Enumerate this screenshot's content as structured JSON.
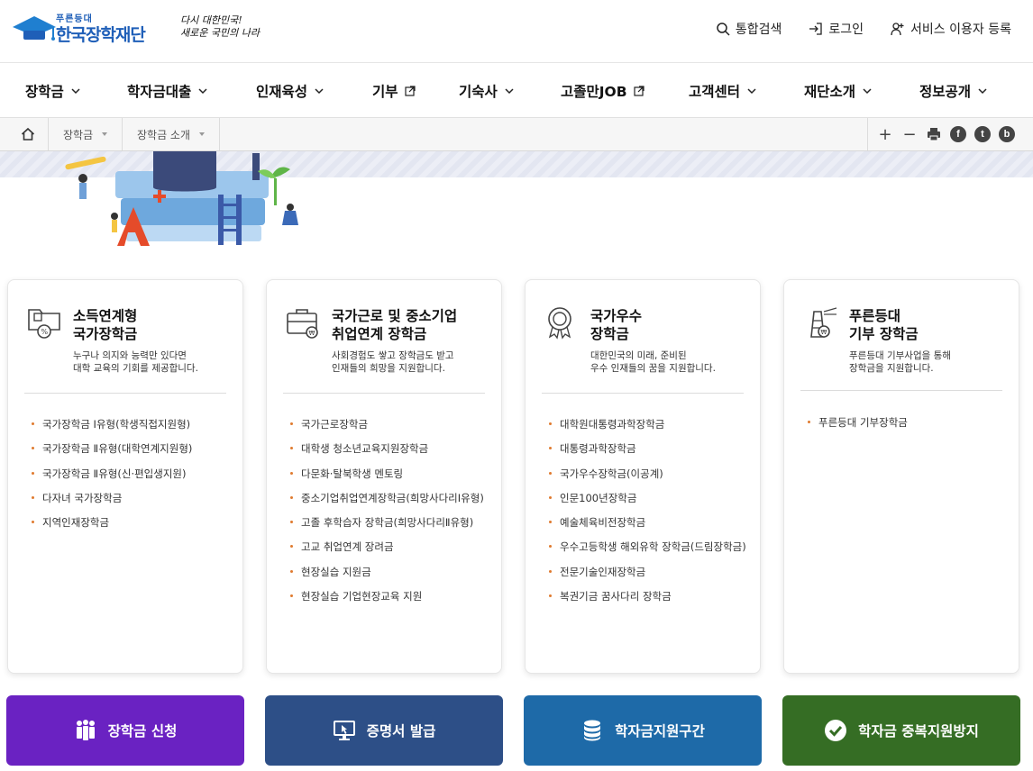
{
  "header": {
    "logo_sub": "푸른등대",
    "logo_name": "한국장학재단",
    "slogan_line1": "다시 대한민국!",
    "slogan_line2": "새로운 국민의 나라",
    "util": [
      {
        "label": "통합검색",
        "icon": "search-icon"
      },
      {
        "label": "로그인",
        "icon": "login-icon"
      },
      {
        "label": "서비스 이용자 등록",
        "icon": "user-add-icon"
      }
    ]
  },
  "gnb": [
    {
      "label": "장학금",
      "icon": "chevron-down-icon"
    },
    {
      "label": "학자금대출",
      "icon": "chevron-down-icon"
    },
    {
      "label": "인재육성",
      "icon": "chevron-down-icon"
    },
    {
      "label": "기부",
      "icon": "external-link-icon"
    },
    {
      "label": "기숙사",
      "icon": "chevron-down-icon"
    },
    {
      "label": "고졸만JOB",
      "icon": "external-link-icon"
    },
    {
      "label": "고객센터",
      "icon": "chevron-down-icon"
    },
    {
      "label": "재단소개",
      "icon": "chevron-down-icon"
    },
    {
      "label": "정보공개",
      "icon": "chevron-down-icon"
    }
  ],
  "breadcrumb": {
    "home_icon": "home-icon",
    "items": [
      "장학금",
      "장학금 소개"
    ]
  },
  "tools": {
    "zoom_in": "+",
    "zoom_out": "−",
    "print_icon": "print-icon",
    "facebook": "f",
    "twitter": "t",
    "blog": "b"
  },
  "cards": [
    {
      "icon": "income-scholarship-icon",
      "title": "소득연계형\n국가장학금",
      "desc": "누구나 의지와 능력만 있다면\n대학 교육의 기회를 제공합니다.",
      "items": [
        "국가장학금 Ⅰ유형(학생직접지원형)",
        "국가장학금 Ⅱ유형(대학연계지원형)",
        "국가장학금 Ⅱ유형(신·편입생지원)",
        "다자녀 국가장학금",
        "지역인재장학금"
      ]
    },
    {
      "icon": "briefcase-icon",
      "title": "국가근로 및 중소기업\n취업연계 장학금",
      "desc": "사회경험도 쌓고 장학금도 받고\n인재들의 희망을 지원합니다.",
      "items": [
        "국가근로장학금",
        "대학생 청소년교육지원장학금",
        "다문화·탈북학생 멘토링",
        "중소기업취업연계장학금(희망사다리Ⅰ유형)",
        "고졸 후학습자 장학금(희망사다리Ⅱ유형)",
        "고교 취업연계 장려금",
        "현장실습 지원금",
        "현장실습 기업현장교육 지원"
      ]
    },
    {
      "icon": "award-medal-icon",
      "title": "국가우수\n장학금",
      "desc": "대한민국의 미래, 준비된\n우수 인재들의 꿈을 지원합니다.",
      "items": [
        "대학원대통령과학장학금",
        "대통령과학장학금",
        "국가우수장학금(이공계)",
        "인문100년장학금",
        "예술체육비전장학금",
        "우수고등학생 해외유학 장학금(드림장학금)",
        "전문기술인재장학금",
        "복권기금 꿈사다리 장학금"
      ]
    },
    {
      "icon": "lighthouse-icon",
      "title": "푸른등대\n기부 장학금",
      "desc": "푸른등대 기부사업을 통해\n장학금을 지원합니다.",
      "items": [
        "푸른등대 기부장학금"
      ]
    }
  ],
  "actions": [
    {
      "label": "장학금 신청",
      "icon": "people-icon",
      "color": "#6a22c2"
    },
    {
      "label": "증명서 발급",
      "icon": "monitor-icon",
      "color": "#2d4f87"
    },
    {
      "label": "학자금지원구간",
      "icon": "database-icon",
      "color": "#1e6aa8"
    },
    {
      "label": "학자금 중복지원방지",
      "icon": "check-circle-icon",
      "color": "#356d24"
    }
  ]
}
